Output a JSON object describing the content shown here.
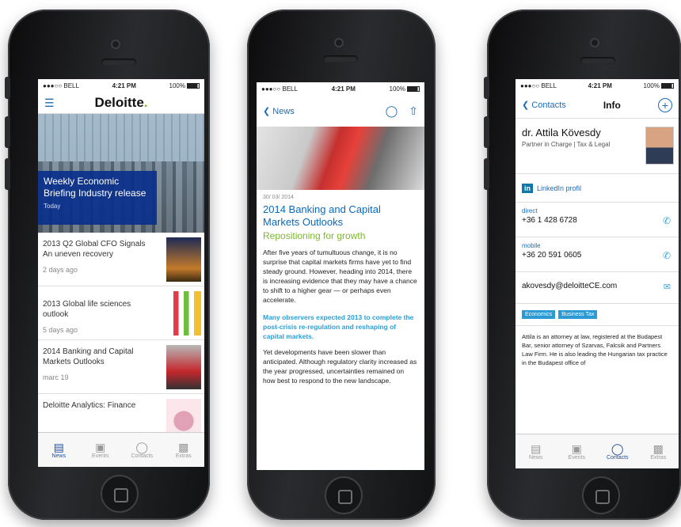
{
  "status": {
    "carrier": "●●●○○ BELL",
    "time": "4:21 PM",
    "battery": "100%"
  },
  "screen1": {
    "menu_icon": "menu-icon",
    "logo": "Deloitte",
    "logo_dot": ".",
    "hero": {
      "title": "Weekly Economic Briefing Industry release",
      "date": "Today"
    },
    "items": [
      {
        "title": "2013 Q2 Global CFO Signals An uneven recovery",
        "date": "2 days ago"
      },
      {
        "title": "2013 Global life sciences outlook",
        "date": "5 days ago"
      },
      {
        "title": "2014 Banking and Capital Markets Outlooks",
        "date": "marc 19"
      },
      {
        "title": "Deloitte Analytics: Finance",
        "date": ""
      }
    ]
  },
  "tabs": [
    "News",
    "Events",
    "Contacts",
    "Extras"
  ],
  "screen2": {
    "back": "News",
    "date": "30/ 03/ 2014",
    "title": "2014 Banking and Capital Markets Outlooks",
    "subtitle": "Repositioning for growth",
    "paragraph1": "After five years of tumultuous change, it is no surprise that capital markets firms have yet to find steady ground. However, heading into 2014, there is increasing evidence that they may have a chance to shift to a higher gear — or perhaps even accelerate.",
    "quote": "Many observers expected 2013 to complete the post-crisis re-regulation and reshaping of capital markets.",
    "paragraph2": "Yet developments have been slower than anticipated. Although regulatory clarity increased as the year progressed, uncertainties remained on how best to respond to the new landscape."
  },
  "screen3": {
    "back": "Contacts",
    "title": "Info",
    "name": "dr. Attila Kövesdy",
    "role": "Partner in Charge | Tax & Legal",
    "linkedin": "LinkedIn profil",
    "direct_label": "direct",
    "direct": "+36 1 428 6728",
    "mobile_label": "mobile",
    "mobile": "+36 20 591 0605",
    "email": "akovesdy@deloitteCE.com",
    "tags": [
      "Economics",
      "Business Tax"
    ],
    "bio": "Attila is an attorney at law, registered at the Budapest Bar, senior attorney of Szarvas, Falcsik and Partners Law Firm. He is also leading the Hungarian tax practice in the Budapest office of"
  }
}
